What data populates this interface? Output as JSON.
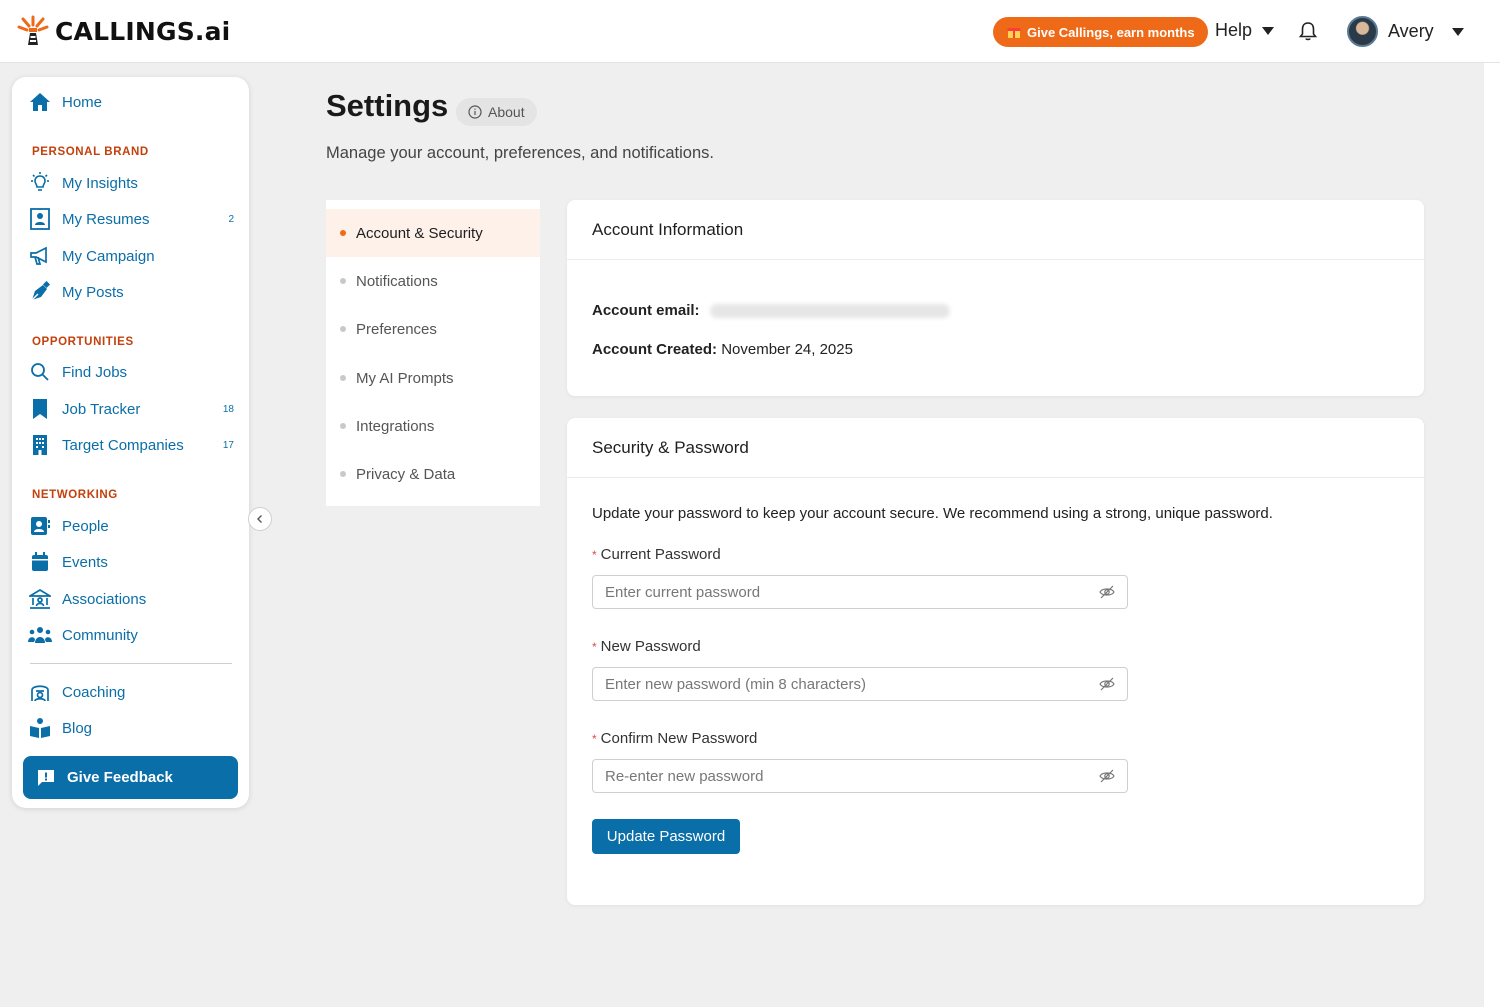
{
  "brand": {
    "name": "CALLINGS",
    "suffix": ".ai",
    "accent": "#ef6a18",
    "primary": "#0a6ea8"
  },
  "topbar": {
    "promo_label": "Give Callings, earn months",
    "help_label": "Help",
    "user_name": "Avery"
  },
  "sidebar": {
    "home": "Home",
    "sections": {
      "personal_brand": "PERSONAL BRAND",
      "opportunities": "OPPORTUNITIES",
      "networking": "NETWORKING"
    },
    "items": {
      "my_insights": "My Insights",
      "my_resumes": "My Resumes",
      "my_resumes_count": "2",
      "my_campaign": "My Campaign",
      "my_posts": "My Posts",
      "find_jobs": "Find Jobs",
      "job_tracker": "Job Tracker",
      "job_tracker_count": "18",
      "target_companies": "Target Companies",
      "target_companies_count": "17",
      "people": "People",
      "events": "Events",
      "associations": "Associations",
      "community": "Community",
      "coaching": "Coaching",
      "blog": "Blog"
    },
    "feedback_label": "Give Feedback"
  },
  "page": {
    "title": "Settings",
    "about_label": "About",
    "subtitle": "Manage your account, preferences, and notifications."
  },
  "menu": {
    "items": [
      "Account & Security",
      "Notifications",
      "Preferences",
      "My AI Prompts",
      "Integrations",
      "Privacy & Data"
    ],
    "active": "Account & Security"
  },
  "account_info": {
    "title": "Account Information",
    "email_label": "Account email:",
    "created_label": "Account Created:",
    "created_value": "November 24, 2025"
  },
  "security": {
    "title": "Security & Password",
    "description": "Update your password to keep your account secure. We recommend using a strong, unique password.",
    "required_mark": "*",
    "current_label": "Current Password",
    "current_placeholder": "Enter current password",
    "new_label": "New Password",
    "new_placeholder": "Enter new password (min 8 characters)",
    "confirm_label": "Confirm New Password",
    "confirm_placeholder": "Re-enter new password",
    "submit_label": "Update Password"
  }
}
